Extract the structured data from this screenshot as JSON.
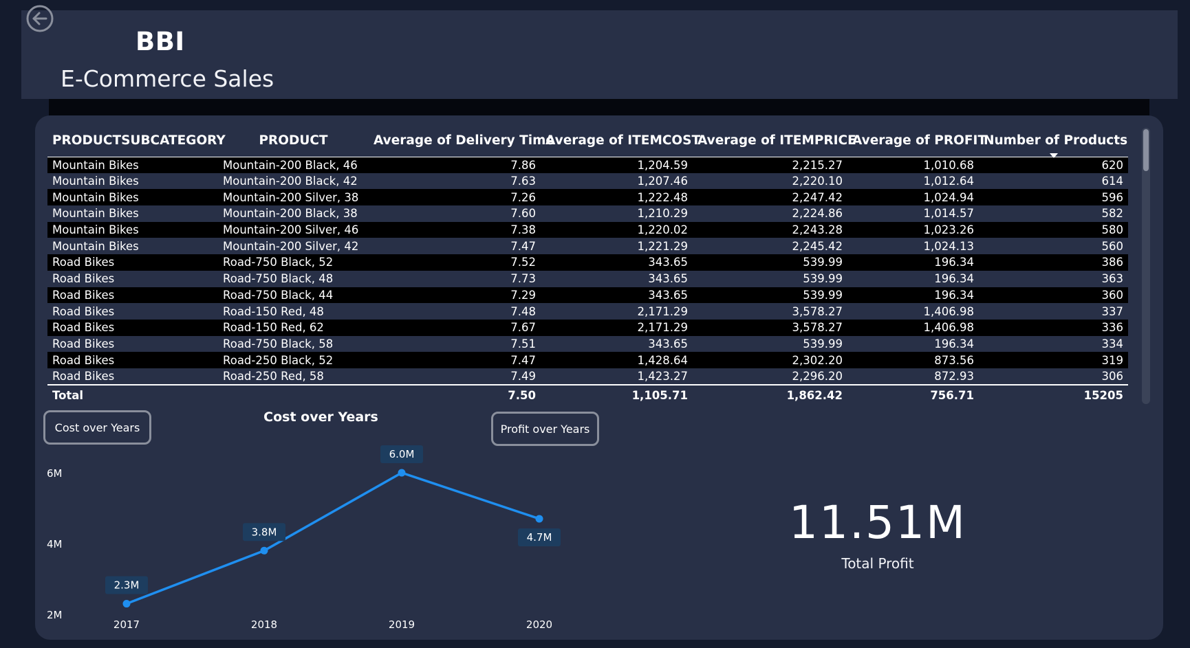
{
  "header": {
    "brand": "BBI",
    "title": "E-Commerce Sales"
  },
  "table": {
    "columns": [
      "PRODUCTSUBCATEGORY",
      "PRODUCT",
      "Average of Delivery Time",
      "Average of ITEMCOST",
      "Average of ITEMPRICE",
      "Average of PROFIT",
      "Number of Products"
    ],
    "rows": [
      [
        "Mountain Bikes",
        "Mountain-200 Black, 46",
        "7.86",
        "1,204.59",
        "2,215.27",
        "1,010.68",
        "620"
      ],
      [
        "Mountain Bikes",
        "Mountain-200 Black, 42",
        "7.63",
        "1,207.46",
        "2,220.10",
        "1,012.64",
        "614"
      ],
      [
        "Mountain Bikes",
        "Mountain-200 Silver, 38",
        "7.26",
        "1,222.48",
        "2,247.42",
        "1,024.94",
        "596"
      ],
      [
        "Mountain Bikes",
        "Mountain-200 Black, 38",
        "7.60",
        "1,210.29",
        "2,224.86",
        "1,014.57",
        "582"
      ],
      [
        "Mountain Bikes",
        "Mountain-200 Silver, 46",
        "7.38",
        "1,220.02",
        "2,243.28",
        "1,023.26",
        "580"
      ],
      [
        "Mountain Bikes",
        "Mountain-200 Silver, 42",
        "7.47",
        "1,221.29",
        "2,245.42",
        "1,024.13",
        "560"
      ],
      [
        "Road Bikes",
        "Road-750 Black, 52",
        "7.52",
        "343.65",
        "539.99",
        "196.34",
        "386"
      ],
      [
        "Road Bikes",
        "Road-750 Black, 48",
        "7.73",
        "343.65",
        "539.99",
        "196.34",
        "363"
      ],
      [
        "Road Bikes",
        "Road-750 Black, 44",
        "7.29",
        "343.65",
        "539.99",
        "196.34",
        "360"
      ],
      [
        "Road Bikes",
        "Road-150 Red, 48",
        "7.48",
        "2,171.29",
        "3,578.27",
        "1,406.98",
        "337"
      ],
      [
        "Road Bikes",
        "Road-150 Red, 62",
        "7.67",
        "2,171.29",
        "3,578.27",
        "1,406.98",
        "336"
      ],
      [
        "Road Bikes",
        "Road-750 Black, 58",
        "7.51",
        "343.65",
        "539.99",
        "196.34",
        "334"
      ],
      [
        "Road Bikes",
        "Road-250 Black, 52",
        "7.47",
        "1,428.64",
        "2,302.20",
        "873.56",
        "319"
      ],
      [
        "Road Bikes",
        "Road-250 Red, 58",
        "7.49",
        "1,423.27",
        "2,296.20",
        "872.93",
        "306"
      ]
    ],
    "total": [
      "Total",
      "",
      "7.50",
      "1,105.71",
      "1,862.42",
      "756.71",
      "15205"
    ],
    "sort_column": "Number of Products",
    "sort_direction": "descending"
  },
  "buttons": {
    "cost_label": "Cost over Years",
    "profit_label": "Profit over Years"
  },
  "chart_data": {
    "type": "line",
    "title": "Cost over Years",
    "x": [
      "2017",
      "2018",
      "2019",
      "2020"
    ],
    "values": [
      2.3,
      3.8,
      6.0,
      4.7
    ],
    "data_labels": [
      "2.3M",
      "3.8M",
      "6.0M",
      "4.7M"
    ],
    "y_ticks": [
      2,
      4,
      6
    ],
    "y_tick_labels": [
      "2M",
      "4M",
      "6M"
    ],
    "ylim": [
      2,
      6
    ],
    "grid": false,
    "line_color": "#1f8ff0",
    "xlabel": "",
    "ylabel": ""
  },
  "kpi": {
    "value": "11.51M",
    "label": "Total Profit"
  }
}
